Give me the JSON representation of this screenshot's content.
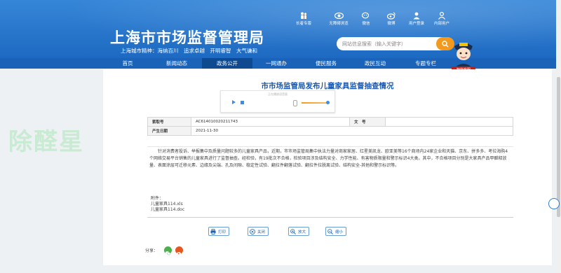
{
  "header": {
    "site_title": "上海市市场监督管理局",
    "city_spirit": "上海城市精神：海纳百川　追求卓越　开明睿智　大气谦和",
    "top_links": [
      "长者专版",
      "无障碍浏览",
      "微信",
      "微博",
      "用户登录",
      "内部用户"
    ],
    "search_placeholder": "网站信息搜索（输入关键字）",
    "mascot_label": "智能客服"
  },
  "nav": {
    "items": [
      "首页",
      "新闻动态",
      "政务公开",
      "一网通办",
      "便民服务",
      "政民互动",
      "专题专栏"
    ],
    "active": "政务公开"
  },
  "article": {
    "title": "市市场监管局发布儿童家具监督抽查情况",
    "audio_caption": "正在播放语音版",
    "meta": {
      "index_label": "索取号",
      "index_value": "AC614010020211743",
      "doc_label": "文　号",
      "doc_value": "",
      "date_label": "产生日期",
      "date_value": "2021-11-30"
    },
    "body": "针对消费者投诉、举报集中及质量问题较多的儿童家具产品，近期，市市场监管局集中执法力量对商家家居、红星美凯龙、欧亚美等16个商场内24家企业和天猫、京东、拼多多、考拉海购4个网络交易平台销售的儿童家具进行了监督抽查。经检验，有19批次不合格，检验项目涉及结构安全、力学性能、有害物质限量和警示标识4大类。其中，不合格项目分别是大家具产品甲醛释放量、表面涂层可迁移元素、边缘及尖端、孔及间隙、稳定性试验、翻拉件翻落试验、翻拉件拉脱离试验、结构安全-其他和警示标识等。",
    "attachments_label": "附件：",
    "attachments": [
      "儿童家具114.xls",
      "儿童家具114.doc"
    ],
    "actions": [
      "打印",
      "关闭",
      "放大",
      "缩小"
    ],
    "share_label": "分享："
  },
  "watermark": "除醛星",
  "colors": {
    "header_blue": "#2a7fd6",
    "nav_blue": "#1b63b8",
    "title_blue": "#1a58b0",
    "search_orange": "#f39a1e"
  }
}
